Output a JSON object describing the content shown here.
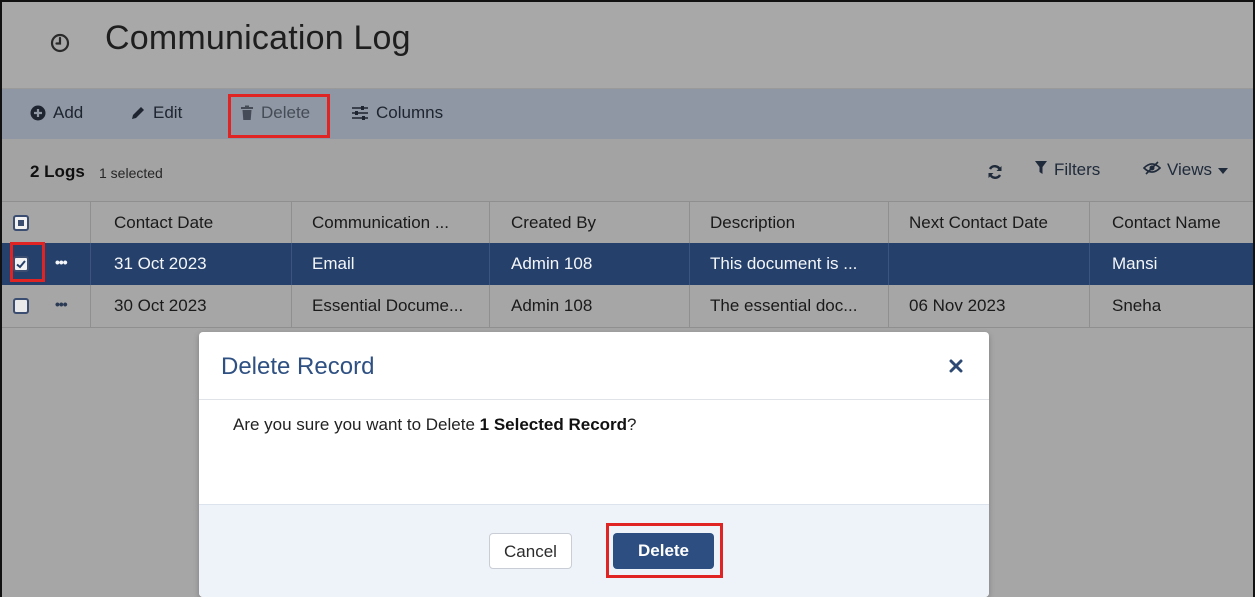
{
  "page": {
    "title": "Communication Log"
  },
  "toolbar": {
    "add_label": "Add",
    "edit_label": "Edit",
    "delete_label": "Delete",
    "columns_label": "Columns"
  },
  "summary": {
    "count_label": "2 Logs",
    "selected_label": "1 selected",
    "filters_label": "Filters",
    "views_label": "Views"
  },
  "table": {
    "columns": [
      "Contact Date",
      "Communication ...",
      "Created By",
      "Description",
      "Next Contact Date",
      "Contact Name"
    ],
    "rows": [
      {
        "selected": true,
        "cells": [
          "31 Oct 2023",
          "Email",
          "Admin 108",
          "This document is ...",
          "",
          "Mansi"
        ]
      },
      {
        "selected": false,
        "cells": [
          "30 Oct 2023",
          "Essential Docume...",
          "Admin 108",
          "The essential doc...",
          "06 Nov 2023",
          "Sneha"
        ]
      }
    ]
  },
  "dialog": {
    "title": "Delete Record",
    "message_prefix": "Are you sure you want to Delete ",
    "message_bold": "1 Selected Record",
    "message_suffix": "?",
    "cancel_label": "Cancel",
    "confirm_label": "Delete"
  },
  "colors": {
    "highlight": "#e02424",
    "selected_row": "#25406a",
    "primary_button": "#2c4e80",
    "dialog_title": "#2e5082"
  },
  "icons": {
    "title": "clock-icon",
    "add": "plus-circle-icon",
    "edit": "pencil-icon",
    "delete": "trash-icon",
    "columns": "sliders-icon",
    "refresh": "refresh-icon",
    "filters": "funnel-icon",
    "views": "eye-slash-icon",
    "row_actions": "ellipsis-icon",
    "close": "close-icon"
  }
}
